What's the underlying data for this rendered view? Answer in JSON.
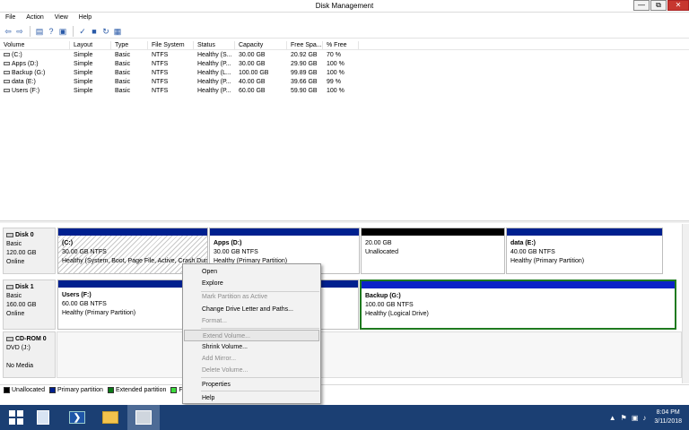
{
  "window": {
    "title": "Disk Management",
    "minimize": "—",
    "restore": "⧉",
    "close": "✕"
  },
  "menu": [
    "File",
    "Action",
    "View",
    "Help"
  ],
  "toolbar": {
    "icons": [
      "back-arrow-icon",
      "forward-arrow-icon",
      "show-hide-console-tree-icon",
      "help-icon",
      "properties-icon",
      "check-icon",
      "folder-open-icon",
      "rescan-icon",
      "disk-list-icon"
    ],
    "glyphs": [
      "⇦",
      "⇨",
      "▤",
      "?",
      "▣",
      "✓",
      "■",
      "↻",
      "▦"
    ]
  },
  "columns": [
    "Volume",
    "Layout",
    "Type",
    "File System",
    "Status",
    "Capacity",
    "Free Spa...",
    "% Free"
  ],
  "volumes": [
    [
      "(C:)",
      "Simple",
      "Basic",
      "NTFS",
      "Healthy (S...",
      "30.00 GB",
      "20.92 GB",
      "70 %"
    ],
    [
      "Apps (D:)",
      "Simple",
      "Basic",
      "NTFS",
      "Healthy (P...",
      "30.00 GB",
      "29.90 GB",
      "100 %"
    ],
    [
      "Backup (G:)",
      "Simple",
      "Basic",
      "NTFS",
      "Healthy (L...",
      "100.00 GB",
      "99.89 GB",
      "100 %"
    ],
    [
      "data (E:)",
      "Simple",
      "Basic",
      "NTFS",
      "Healthy (P...",
      "40.00 GB",
      "39.66 GB",
      "99 %"
    ],
    [
      "Users (F:)",
      "Simple",
      "Basic",
      "NTFS",
      "Healthy (P...",
      "60.00 GB",
      "59.90 GB",
      "100 %"
    ]
  ],
  "disks": [
    {
      "name": "Disk 0",
      "type": "Basic",
      "size": "120.00 GB",
      "state": "Online",
      "partitions": [
        {
          "name": "(C:)",
          "size": "30.00 GB NTFS",
          "status": "Healthy (System, Boot, Page File, Active, Crash Dum"
        },
        {
          "name": "Apps  (D:)",
          "size": "30.00 GB NTFS",
          "status": "Healthy (Primary Partition)"
        },
        {
          "name": "",
          "size": "20.00 GB",
          "status": "Unallocated"
        },
        {
          "name": "data  (E:)",
          "size": "40.00 GB NTFS",
          "status": "Healthy (Primary Partition)"
        }
      ]
    },
    {
      "name": "Disk 1",
      "type": "Basic",
      "size": "160.00 GB",
      "state": "Online",
      "partitions": [
        {
          "name": "Users  (F:)",
          "size": "60.00 GB NTFS",
          "status": "Healthy (Primary Partition)"
        },
        {
          "name": "Backup  (G:)",
          "size": "100.00 GB NTFS",
          "status": "Healthy (Logical Drive)"
        }
      ]
    },
    {
      "name": "CD-ROM 0",
      "type": "DVD (J:)",
      "state": "No Media"
    }
  ],
  "legend": [
    {
      "label": "Unallocated",
      "color": "#000000"
    },
    {
      "label": "Primary partition",
      "color": "#00208f"
    },
    {
      "label": "Extended partition",
      "color": "#0b7a16"
    },
    {
      "label": "F",
      "color": "#3ddc3d"
    }
  ],
  "context_menu": [
    {
      "label": "Open",
      "enabled": true
    },
    {
      "label": "Explore",
      "enabled": true
    },
    {
      "label": "Mark Partition as Active",
      "enabled": false
    },
    {
      "label": "Change Drive Letter and Paths...",
      "enabled": true
    },
    {
      "label": "Format...",
      "enabled": false
    },
    {
      "label": "Extend Volume...",
      "enabled": false,
      "highlighted": true
    },
    {
      "label": "Shrink Volume...",
      "enabled": true
    },
    {
      "label": "Add Mirror...",
      "enabled": false
    },
    {
      "label": "Delete Volume...",
      "enabled": false
    },
    {
      "label": "Properties",
      "enabled": true
    },
    {
      "label": "Help",
      "enabled": true
    }
  ],
  "colors": {
    "primary": "#00208f",
    "unallocated": "#000000",
    "logical": "#0b22c8",
    "selected_border": "#1f7a1f",
    "taskbar": "#1b3f73"
  },
  "taskbar": {
    "apps": [
      "start-icon",
      "server-manager-icon",
      "powershell-icon",
      "file-explorer-icon",
      "disk-management-icon"
    ],
    "powershell_glyph": "❯",
    "tray": [
      "▲",
      "⚑",
      "▣",
      "♪"
    ],
    "time": "8:04 PM",
    "date": "3/11/2018"
  }
}
